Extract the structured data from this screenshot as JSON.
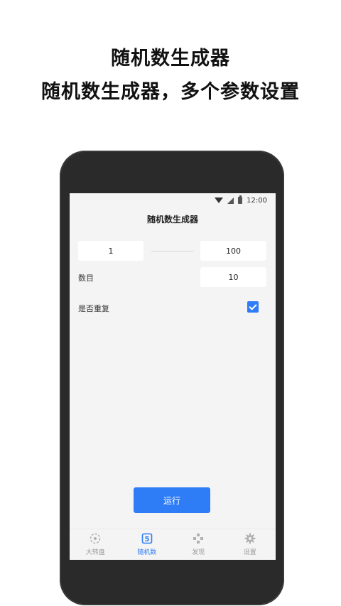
{
  "promo": {
    "line1": "随机数生成器",
    "line2": "随机数生成器，多个参数设置"
  },
  "statusbar": {
    "time": "12:00"
  },
  "app": {
    "title": "随机数生成器",
    "min_value": "1",
    "max_value": "100",
    "count_label": "数目",
    "count_value": "10",
    "repeat_label": "是否重复",
    "repeat_checked": true,
    "run_label": "运行"
  },
  "tabs": [
    {
      "label": "大转盘",
      "icon": "wheel-icon"
    },
    {
      "label": "随机数",
      "icon": "random-number-icon"
    },
    {
      "label": "发现",
      "icon": "gamepad-icon"
    },
    {
      "label": "设置",
      "icon": "gear-icon"
    }
  ],
  "colors": {
    "accent": "#2f7df6",
    "background": "#f4f4f4",
    "phone": "#2a2a2a"
  }
}
